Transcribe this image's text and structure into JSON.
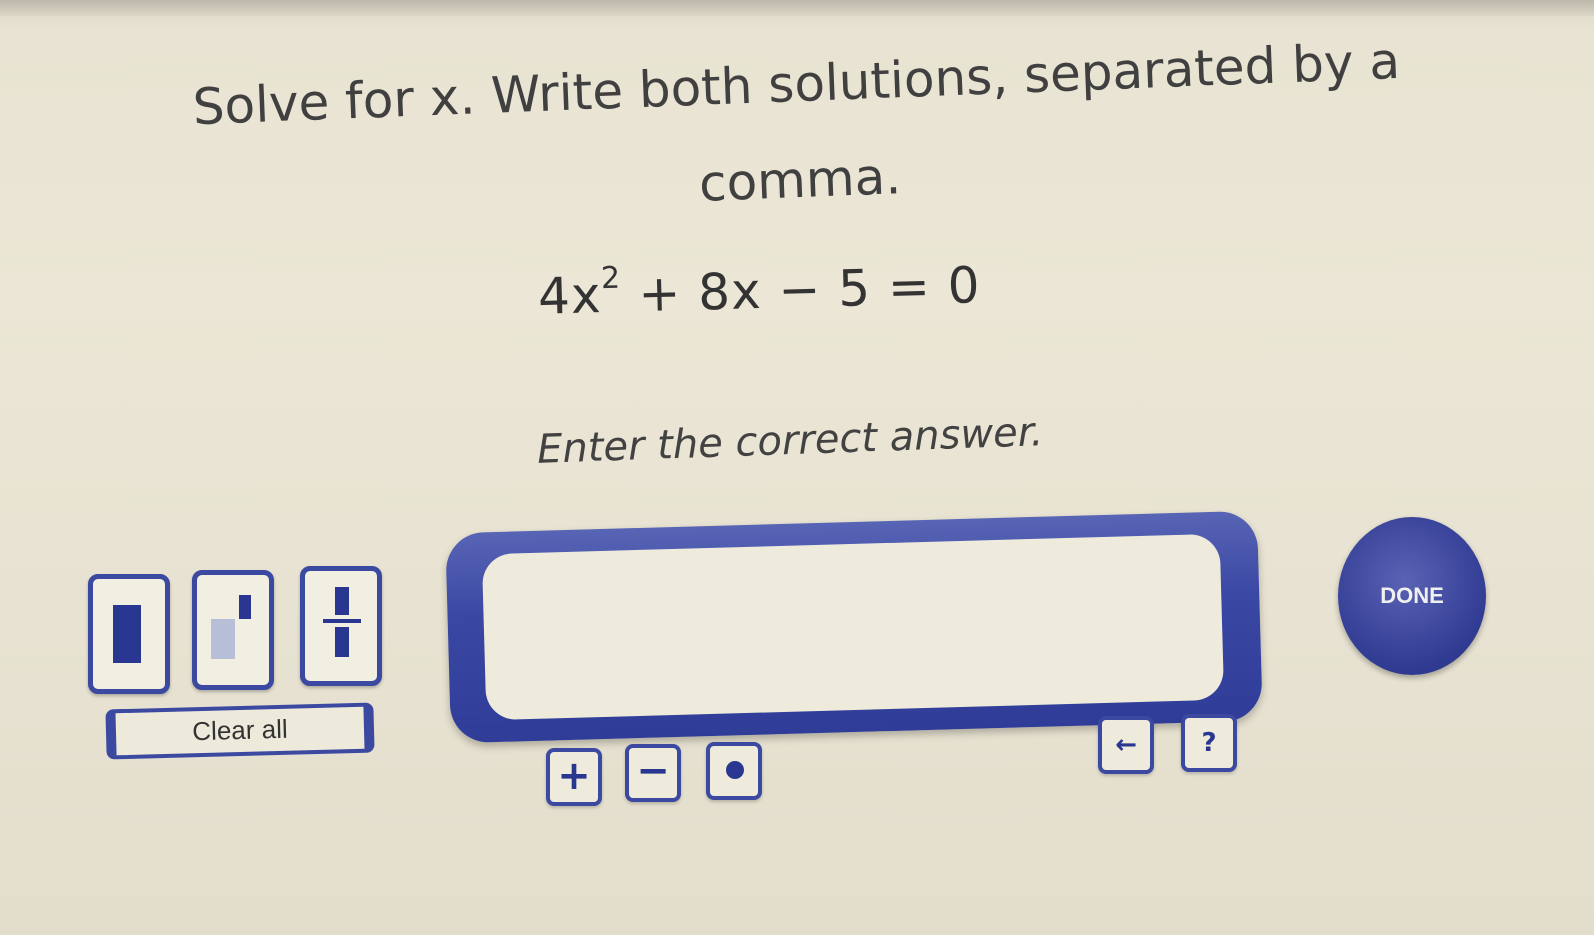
{
  "question": {
    "prompt_line1": "Solve for x. Write both solutions, separated by a",
    "prompt_line2": "comma.",
    "equation_lead": "4x",
    "equation_exponent": "2",
    "equation_rest": " + 8x − 5 = 0",
    "instruction": "Enter the correct answer."
  },
  "toolbar": {
    "templates": [
      {
        "name": "box-template-icon"
      },
      {
        "name": "exponent-template-icon"
      },
      {
        "name": "fraction-template-icon"
      }
    ],
    "clear_label": "Clear all"
  },
  "answer": {
    "value": "",
    "placeholder": ""
  },
  "done_label": "DONE",
  "keypad": {
    "plus": "+",
    "minus": "−",
    "backspace": "←",
    "help": "?"
  },
  "colors": {
    "accent": "#3b4aa0",
    "dark_accent": "#2a3790",
    "background": "#ebe6d5"
  }
}
